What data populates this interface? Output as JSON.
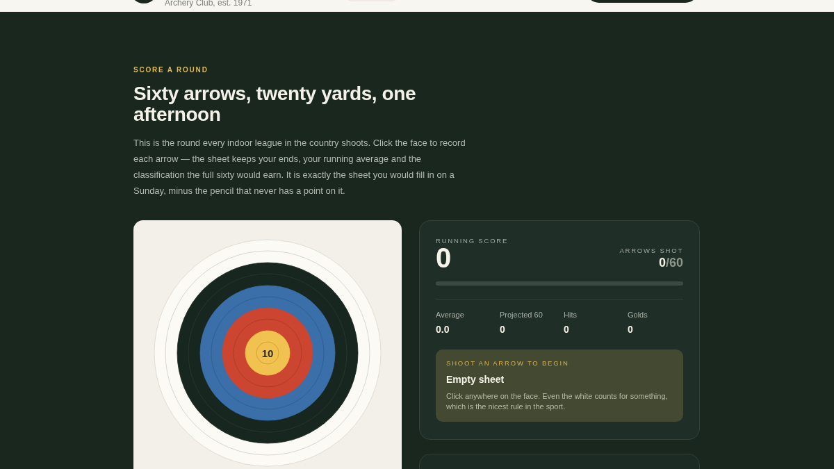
{
  "header": {
    "brand_subtitle": "Archery Club, est. 1971"
  },
  "intro": {
    "eyebrow": "SCORE A ROUND",
    "title": "Sixty arrows, twenty yards, one afternoon",
    "body": "This is the round every indoor league in the country shoots. Click the face to record each arrow — the sheet keeps your ends, your running average and the classification the full sixty would earn. It is exactly the sheet you would fill in on a Sunday, minus the pencil that never has a point on it."
  },
  "target": {
    "center_label": "10"
  },
  "scorecard": {
    "running_score_label": "RUNNING SCORE",
    "running_score": "0",
    "arrows_label": "ARROWS SHOT",
    "arrows_shot": "0",
    "arrows_total": "/60",
    "progress": {
      "level": 0
    },
    "stats": [
      {
        "label": "Average",
        "value": "0.0"
      },
      {
        "label": "Projected 60",
        "value": "0"
      },
      {
        "label": "Hits",
        "value": "0"
      },
      {
        "label": "Golds",
        "value": "0"
      }
    ],
    "callout": {
      "eyebrow": "SHOOT AN ARROW TO BEGIN",
      "title": "Empty sheet",
      "body": "Click anywhere on the face. Even the white counts for something, which is the nicest rule in the sport."
    }
  }
}
